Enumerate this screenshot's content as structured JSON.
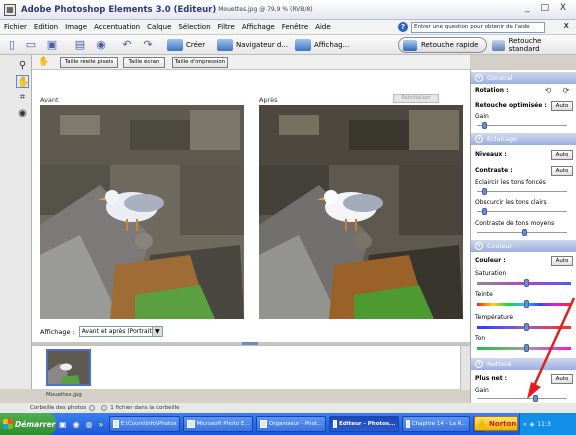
{
  "window": {
    "app_title": "Adobe Photoshop Elements 3.0 (Editeur)",
    "doc_title": "Mouettes.jpg @ 79,9 % (RVB/8)",
    "controls": "_ □ X"
  },
  "menu": {
    "items": [
      "Fichier",
      "Edition",
      "Image",
      "Accentuation",
      "Calque",
      "Sélection",
      "Filtre",
      "Affichage",
      "Fenêtre",
      "Aide"
    ],
    "ask_placeholder": "Entrer une question pour obtenir de l'aide",
    "close": "x"
  },
  "toolbar": {
    "create": "Créer",
    "navigator": "Navigateur d...",
    "view": "Affichag...",
    "quick_fix": "Retouche rapide",
    "standard_edit": "Retouche standard"
  },
  "options": {
    "actual_pixels": "Taille réelle pixels",
    "fit_screen": "Taille écran",
    "print_size": "Taille d'impression"
  },
  "workspace": {
    "before": "Avant",
    "after": "Après",
    "reset": "Réinitialiser",
    "view_label": "Affichage :",
    "view_value": "Avant et après (Portrait)"
  },
  "bin": {
    "thumbnail_caption": "Mouettes.jpg",
    "status_label": "Corbeille des photos",
    "status_count": "1 fichier dans la corbeille"
  },
  "palette": {
    "general": {
      "title": "Général",
      "rotation": "Rotation :",
      "smart_fix": "Retouche optimisée :",
      "auto": "Auto",
      "amount": "Gain",
      "amount_value": 0.05
    },
    "lighting": {
      "title": "Eclairage",
      "levels": "Niveaux :",
      "contrast": "Contraste :",
      "auto": "Auto",
      "lighten_shadows": "Eclaircir les tons foncés",
      "darken_highlights": "Obscurcir les tons clairs",
      "midtone_contrast": "Contraste de tons moyens",
      "lighten_value": 0.05,
      "darken_value": 0.05,
      "midtone_value": 0.5
    },
    "color": {
      "title": "Couleur",
      "color_label": "Couleur :",
      "auto": "Auto",
      "saturation": "Saturation",
      "hue": "Teinte",
      "temperature": "Température",
      "tint": "Ton",
      "saturation_value": 0.5,
      "hue_value": 0.5,
      "temperature_value": 0.5,
      "tint_value": 0.5
    },
    "sharpen": {
      "title": "Netteté",
      "sharpen_label": "Plus net :",
      "auto": "Auto",
      "amount": "Gain",
      "amount_value": 0.62
    }
  },
  "taskbar": {
    "start": "Démarrer",
    "more": "»",
    "tasks": [
      "E:\\Cours\\Info\\Photos",
      "Microsoft Photo E...",
      "Organiseur - Phot...",
      "Editeur - Photos...",
      "Chapitre 14 - La R..."
    ],
    "norton": "Norton",
    "tray_more": "«",
    "clock": "11:3"
  },
  "colors": {
    "accent": "#3f73c0",
    "palette_header": "#9aaee0",
    "annotation": "#e02020"
  }
}
